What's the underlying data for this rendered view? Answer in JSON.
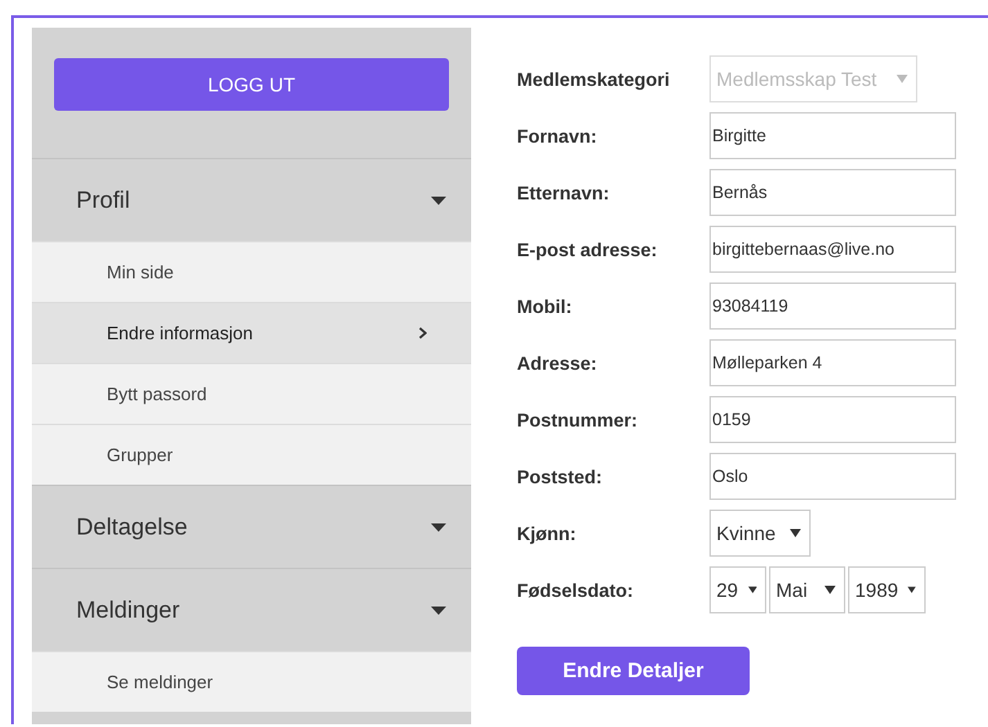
{
  "sidebar": {
    "logout_button": "LOGG UT",
    "sections": [
      {
        "label": "Profil",
        "children": [
          {
            "label": "Min side",
            "selected": false
          },
          {
            "label": "Endre informasjon",
            "selected": true
          },
          {
            "label": "Bytt passord",
            "selected": false
          },
          {
            "label": "Grupper",
            "selected": false
          }
        ]
      },
      {
        "label": "Deltagelse"
      },
      {
        "label": "Meldinger",
        "children": [
          {
            "label": "Se meldinger",
            "selected": false
          }
        ]
      }
    ]
  },
  "form": {
    "fields": [
      {
        "kind": "select",
        "label": "Medlemskategori",
        "value": "Medlemsskap Test",
        "disabled": true
      },
      {
        "kind": "text",
        "label": "Fornavn:",
        "value": "Birgitte"
      },
      {
        "kind": "text",
        "label": "Etternavn:",
        "value": "Bernås"
      },
      {
        "kind": "text",
        "label": "E-post adresse:",
        "value": "birgittebernaas@live.no"
      },
      {
        "kind": "text",
        "label": "Mobil:",
        "value": "93084119"
      },
      {
        "kind": "text",
        "label": "Adresse:",
        "value": "Mølleparken 4"
      },
      {
        "kind": "text",
        "label": "Postnummer:",
        "value": "0159"
      },
      {
        "kind": "text",
        "label": "Poststed:",
        "value": "Oslo"
      },
      {
        "kind": "select",
        "label": "Kjønn:",
        "value": "Kvinne",
        "disabled": false
      },
      {
        "kind": "date",
        "label": "Fødselsdato:",
        "day": "29",
        "month": "Mai",
        "year": "1989"
      }
    ],
    "submit_button": "Endre Detaljer"
  }
}
